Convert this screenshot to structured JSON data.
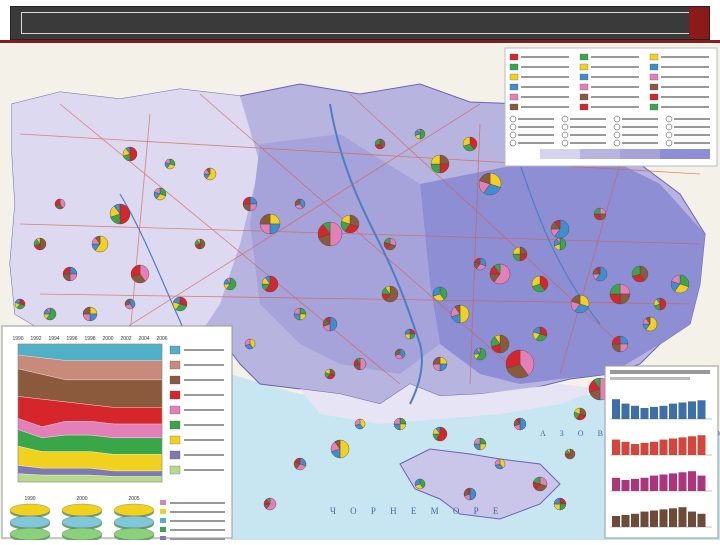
{
  "slide": {
    "title": "",
    "accent_color": "#8b1a1a"
  },
  "map": {
    "sea_labels": [
      "А З О В С Ь К Е   М О Р Е",
      "Ч О Р Н Е   М О Р Е"
    ],
    "colors": {
      "region_fill": "#b8b4e0",
      "region_fill_dark": "#8d8ed4",
      "region_fill_light": "#d6d3ef",
      "sea": "#c8e6f2",
      "foreign_land": "#f4f1e8",
      "pie_red": "#d7262b",
      "pie_green": "#3aa64a",
      "pie_yellow": "#f0d21e",
      "pie_blue": "#3f8ed1",
      "pie_pink": "#e57fb8",
      "pie_brown": "#8b5a3c"
    }
  },
  "legend_top": {
    "headline": "",
    "items": [
      "",
      "",
      "",
      "",
      "",
      "",
      "",
      "",
      ""
    ]
  },
  "inset_left": {
    "chart_title": "",
    "years": [
      "1990",
      "1992",
      "1994",
      "1996",
      "1998",
      "2000",
      "2002",
      "2004",
      "2006"
    ],
    "pie_titles": [
      "1990",
      "2000",
      "2005"
    ],
    "series_colors": [
      "#4fb0c8",
      "#c88a7a",
      "#8b5a3c",
      "#d7262b",
      "#e57fb8",
      "#3aa64a",
      "#f0d21e",
      "#7e7ab0",
      "#b9d98a"
    ]
  },
  "inset_right": {
    "chart_title": "",
    "panels": 4,
    "panel_colors": [
      "#d9c3b0",
      "#3f6fa8",
      "#d9433a",
      "#b0347c",
      "#6e4a38"
    ]
  }
}
